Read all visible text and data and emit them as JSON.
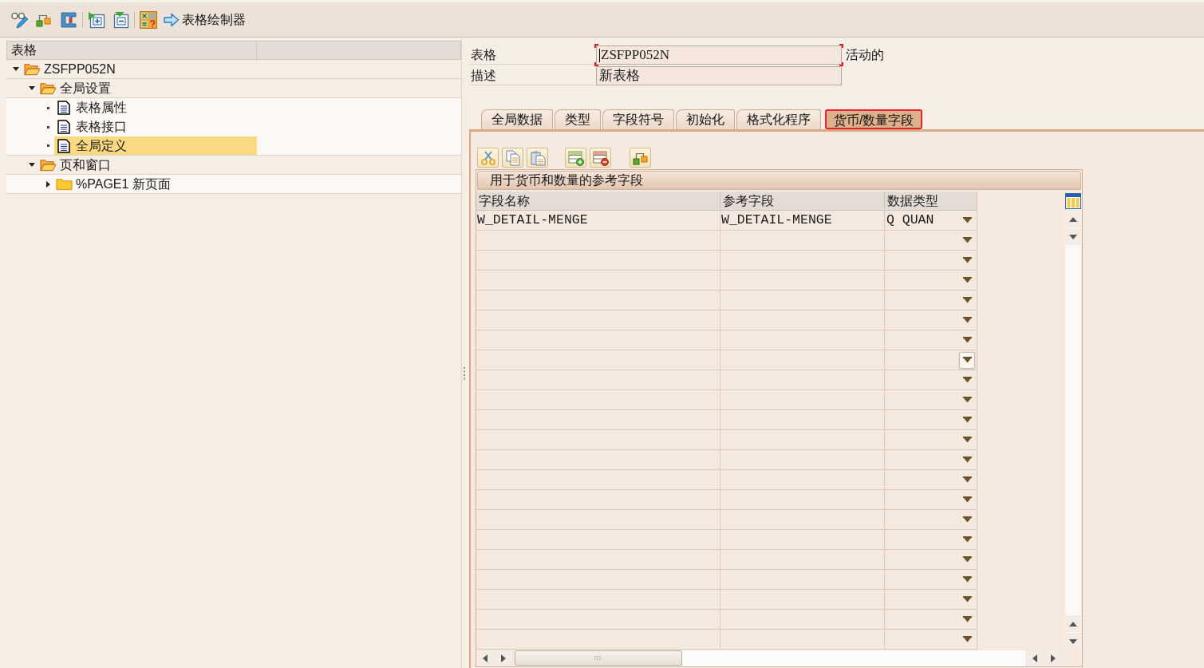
{
  "toolbar": {
    "button_label": "表格绘制器"
  },
  "tree": {
    "column_header": "表格",
    "nodes": [
      {
        "label": "ZSFPP052N",
        "kind": "folder",
        "expanded": true,
        "selected": false,
        "children": [
          {
            "label": "全局设置",
            "kind": "folder",
            "expanded": true,
            "selected": false,
            "children": [
              {
                "label": "表格属性",
                "kind": "document",
                "selected": false
              },
              {
                "label": "表格接口",
                "kind": "document",
                "selected": false
              },
              {
                "label": "全局定义",
                "kind": "document",
                "selected": true
              }
            ]
          },
          {
            "label": "页和窗口",
            "kind": "folder",
            "expanded": true,
            "selected": false,
            "children": [
              {
                "label": "%PAGE1 新页面",
                "kind": "folder",
                "expanded": false,
                "selected": false
              }
            ]
          }
        ]
      }
    ]
  },
  "header_fields": [
    {
      "label": "表格",
      "value": "ZSFPP052N",
      "status": "活动的",
      "focused": true
    },
    {
      "label": "描述",
      "value": "新表格",
      "focused": false
    }
  ],
  "tabs": [
    {
      "label": "全局数据",
      "selected": false
    },
    {
      "label": "类型",
      "selected": false
    },
    {
      "label": "字段符号",
      "selected": false
    },
    {
      "label": "初始化",
      "selected": false
    },
    {
      "label": "格式化程序",
      "selected": false
    },
    {
      "label": "货币/数量字段",
      "selected": true
    }
  ],
  "table": {
    "title": "用于货币和数量的参考字段",
    "columns": [
      "字段名称",
      "参考字段",
      "数据类型"
    ],
    "rows": [
      {
        "field_name": "W_DETAIL-MENGE",
        "reference_field": "W_DETAIL-MENGE",
        "data_type": "Q QUAN",
        "focused": false
      },
      {
        "focused": false
      },
      {
        "focused": false
      },
      {
        "focused": false
      },
      {
        "focused": false
      },
      {
        "focused": false
      },
      {
        "focused": false
      },
      {
        "focused": true
      },
      {
        "focused": false
      },
      {
        "focused": false
      },
      {
        "focused": false
      },
      {
        "focused": false
      },
      {
        "focused": false
      },
      {
        "focused": false
      },
      {
        "focused": false
      },
      {
        "focused": false
      },
      {
        "focused": false
      },
      {
        "focused": false
      },
      {
        "focused": false
      },
      {
        "focused": false
      },
      {
        "focused": false
      },
      {
        "focused": false
      }
    ]
  }
}
